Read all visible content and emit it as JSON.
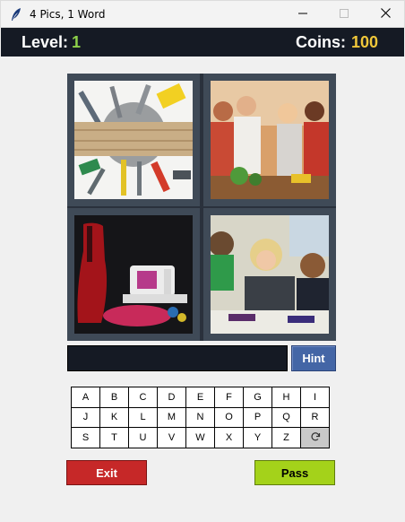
{
  "window": {
    "title": "4 Pics, 1 Word",
    "icon": "feather-icon",
    "controls": [
      "minimize-icon",
      "maximize-icon",
      "close-icon"
    ]
  },
  "header": {
    "level_label": "Level:",
    "level_value": "1",
    "coins_label": "Coins:",
    "coins_value": "100"
  },
  "pictures": [
    {
      "subject": "tools-on-wooden-plank"
    },
    {
      "subject": "people-cooking-in-kitchen"
    },
    {
      "subject": "sewing-machine-and-red-dress"
    },
    {
      "subject": "students-writing-in-classroom"
    }
  ],
  "answer": "",
  "hint_label": "Hint",
  "keyboard": {
    "letters": [
      "A",
      "B",
      "C",
      "D",
      "E",
      "F",
      "G",
      "H",
      "I",
      "J",
      "K",
      "L",
      "M",
      "N",
      "O",
      "P",
      "Q",
      "R",
      "S",
      "T",
      "U",
      "V",
      "W",
      "X",
      "Y",
      "Z"
    ],
    "refresh_icon": "refresh-icon"
  },
  "buttons": {
    "exit_label": "Exit",
    "pass_label": "Pass"
  },
  "colors": {
    "header_bg": "#151a24",
    "level_value": "#8ed14a",
    "coins_value": "#f0c73a",
    "hint_bg": "#4466a6",
    "exit_bg": "#c62828",
    "pass_bg": "#a4d21a"
  }
}
